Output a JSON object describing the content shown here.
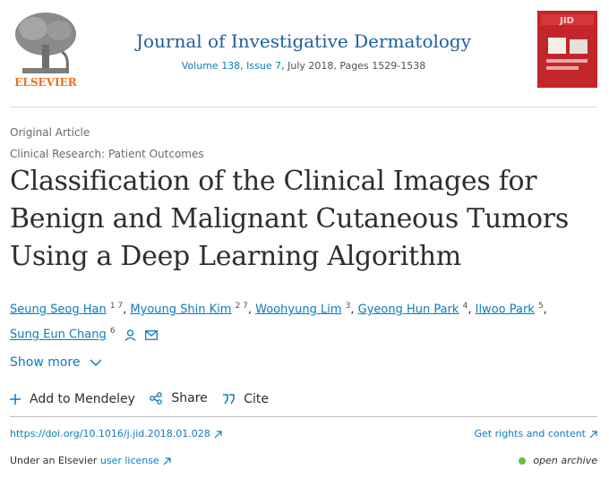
{
  "header": {
    "publisher_logo_text": "ELSEVIER",
    "journal_title": "Journal of Investigative Dermatology",
    "volume_issue": "Volume 138, Issue 7",
    "date_pages": ", July 2018, Pages 1529-1538",
    "cover_label": "JID"
  },
  "article": {
    "type": "Original Article",
    "section": "Clinical Research: Patient Outcomes",
    "title": "Classification of the Clinical Images for Benign and Malignant Cutaneous Tumors Using a Deep Learning Algorithm"
  },
  "authors": [
    {
      "name": "Seung Seog Han",
      "aff": "1 7"
    },
    {
      "name": "Myoung Shin Kim",
      "aff": "2 7"
    },
    {
      "name": "Woohyung Lim",
      "aff": "3"
    },
    {
      "name": "Gyeong Hun Park",
      "aff": "4"
    },
    {
      "name": "Ilwoo Park",
      "aff": "5"
    },
    {
      "name": "Sung Eun Chang",
      "aff": "6"
    }
  ],
  "show_more": "Show more",
  "actions": {
    "mendeley": "Add to Mendeley",
    "share": "Share",
    "cite": "Cite"
  },
  "links": {
    "doi": "https://doi.org/10.1016/j.jid.2018.01.028",
    "rights": "Get rights and content",
    "license_prefix": "Under an Elsevier",
    "license_link": "user license",
    "open_archive": "open archive"
  },
  "colors": {
    "link": "#0c7dbb",
    "journal": "#1c5f9e",
    "publisher": "#e9711c",
    "open_dot": "#66bb44"
  }
}
